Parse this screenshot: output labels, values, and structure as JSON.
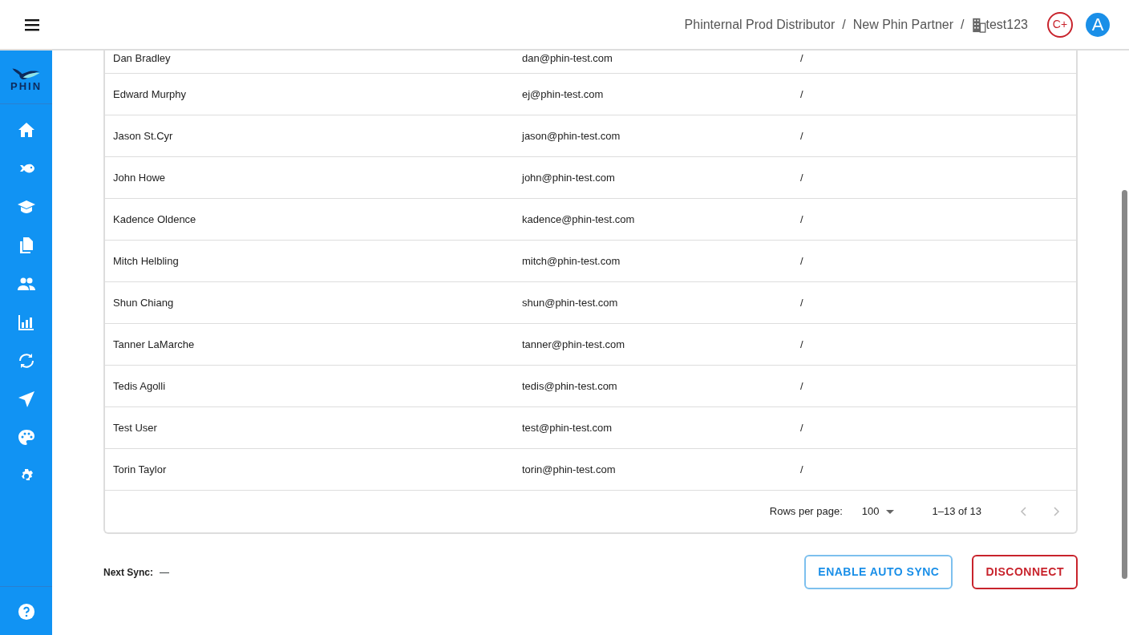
{
  "header": {
    "breadcrumbs": [
      {
        "label": "Phinternal Prod Distributor"
      },
      {
        "label": "New Phin Partner",
        "separator_before": "/"
      },
      {
        "label": "test123",
        "separator_before": "/",
        "kind": "building"
      }
    ],
    "badge": "C+",
    "avatar": "A"
  },
  "sidebar": {
    "logo_text": "PHIN"
  },
  "table": {
    "rows": [
      {
        "name": "Dan Bradley",
        "email": "dan@phin-test.com",
        "column_3": "/"
      },
      {
        "name": "Edward Murphy",
        "email": "ej@phin-test.com",
        "column_3": "/"
      },
      {
        "name": "Jason St.Cyr",
        "email": "jason@phin-test.com",
        "column_3": "/"
      },
      {
        "name": "John Howe",
        "email": "john@phin-test.com",
        "column_3": "/"
      },
      {
        "name": "Kadence Oldence",
        "email": "kadence@phin-test.com",
        "column_3": "/"
      },
      {
        "name": "Mitch Helbling",
        "email": "mitch@phin-test.com",
        "column_3": "/"
      },
      {
        "name": "Shun Chiang",
        "email": "shun@phin-test.com",
        "column_3": "/"
      },
      {
        "name": "Tanner LaMarche",
        "email": "tanner@phin-test.com",
        "column_3": "/"
      },
      {
        "name": "Tedis Agolli",
        "email": "tedis@phin-test.com",
        "column_3": "/"
      },
      {
        "name": "Test User",
        "email": "test@phin-test.com",
        "column_3": "/"
      },
      {
        "name": "Torin Taylor",
        "email": "torin@phin-test.com",
        "column_3": "/"
      }
    ],
    "pagination": {
      "rows_per_page_label": "Rows per page:",
      "rows_per_page": "100",
      "range": "1–13 of 13",
      "previous": {
        "disabled": true
      },
      "next": {
        "disabled": true
      }
    }
  },
  "footer": {
    "next_sync_label": "Next Sync:",
    "next_sync_value": "—",
    "buttons": [
      {
        "label": "ENABLE AUTO SYNC",
        "kind": "primary"
      },
      {
        "label": "DISCONNECT",
        "kind": "danger"
      }
    ]
  }
}
